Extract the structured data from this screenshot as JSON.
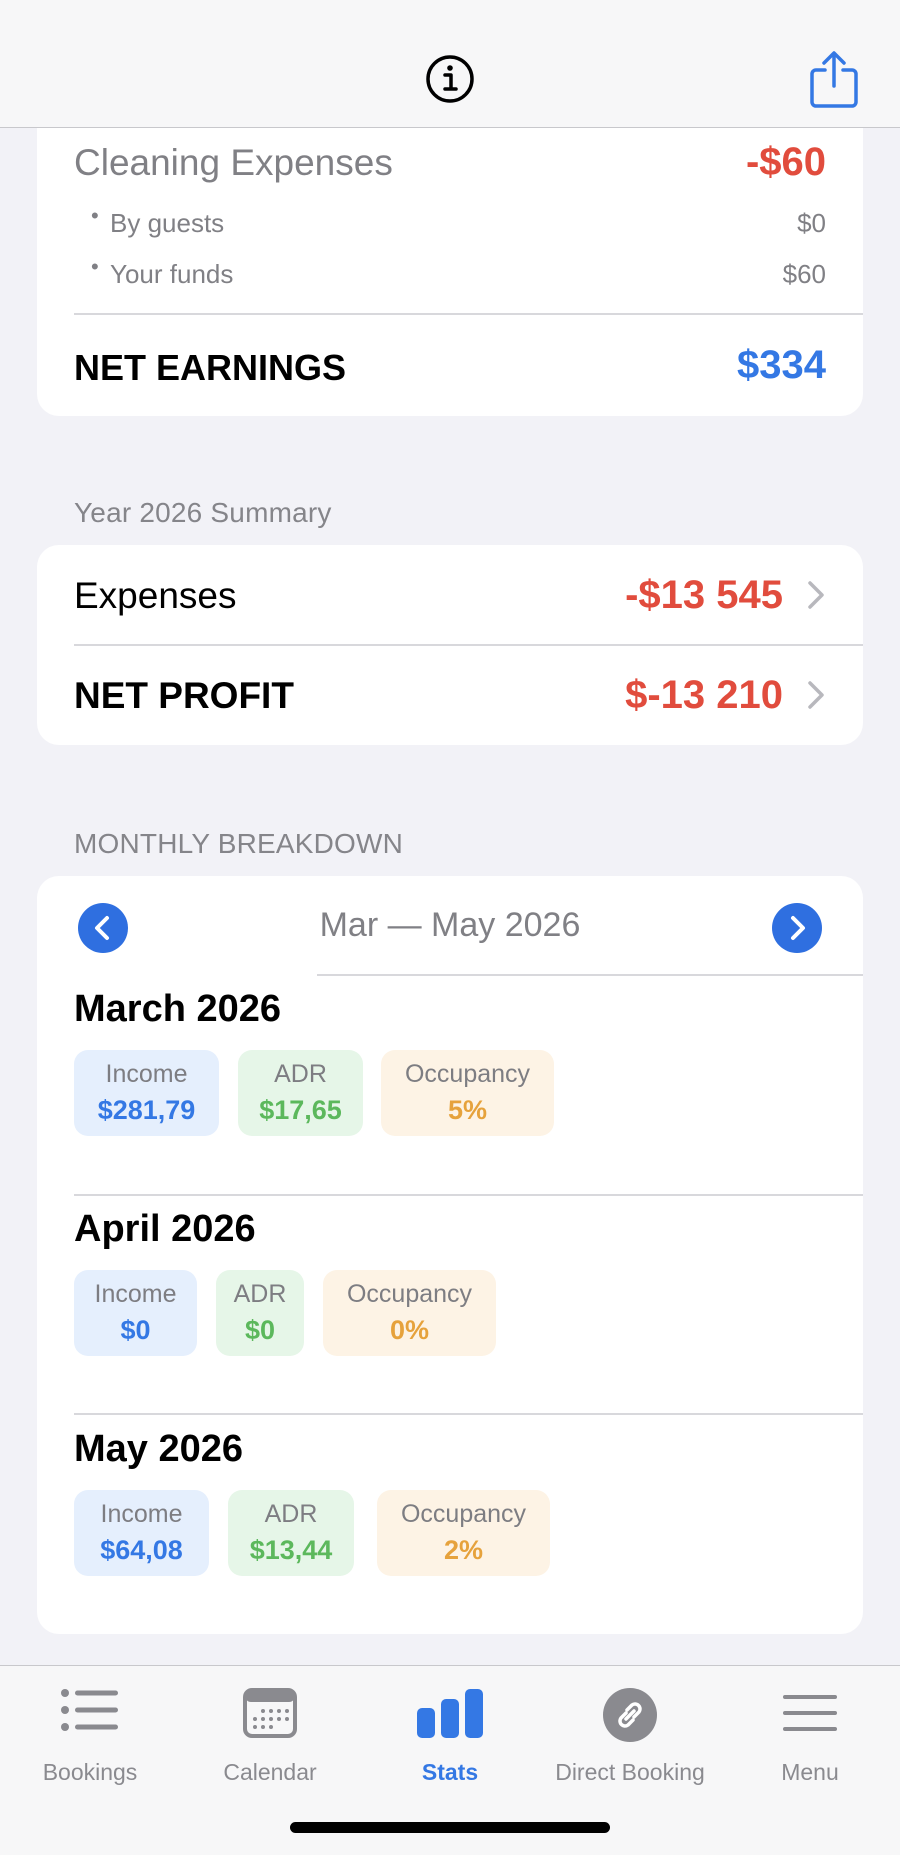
{
  "earnings_card": {
    "cleaning_label": "Cleaning Expenses",
    "cleaning_value": "-$60",
    "by_guests_label": "By guests",
    "by_guests_value": "$0",
    "your_funds_label": "Your funds",
    "your_funds_value": "$60",
    "net_label": "NET EARNINGS",
    "net_value": "$334"
  },
  "year_summary": {
    "header": "Year 2026 Summary",
    "expenses_label": "Expenses",
    "expenses_value": "-$13 545",
    "profit_label": "NET PROFIT",
    "profit_value": "$-13 210"
  },
  "monthly": {
    "header": "MONTHLY BREAKDOWN",
    "range": "Mar — May 2026",
    "months": [
      {
        "title": "March 2026",
        "income_label": "Income",
        "income": "$281,79",
        "adr_label": "ADR",
        "adr": "$17,65",
        "occ_label": "Occupancy",
        "occ": "5%"
      },
      {
        "title": "April 2026",
        "income_label": "Income",
        "income": "$0",
        "adr_label": "ADR",
        "adr": "$0",
        "occ_label": "Occupancy",
        "occ": "0%"
      },
      {
        "title": "May 2026",
        "income_label": "Income",
        "income": "$64,08",
        "adr_label": "ADR",
        "adr": "$13,44",
        "occ_label": "Occupancy",
        "occ": "2%"
      }
    ]
  },
  "tabs": [
    {
      "label": "Bookings",
      "icon": "list-icon"
    },
    {
      "label": "Calendar",
      "icon": "calendar-icon"
    },
    {
      "label": "Stats",
      "icon": "bar-chart-icon",
      "active": true
    },
    {
      "label": "Direct Booking",
      "icon": "link-icon"
    },
    {
      "label": "Menu",
      "icon": "hamburger-icon"
    }
  ],
  "colors": {
    "accent": "#3478e4",
    "negative": "#e14c3d",
    "adr_green": "#5cb85c",
    "occupancy_orange": "#e6a23c"
  }
}
